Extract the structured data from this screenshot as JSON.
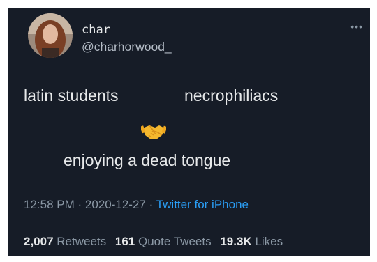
{
  "author": {
    "display_name": "char",
    "handle": "@charhorwood_"
  },
  "tweet": {
    "left_label": "latin students",
    "right_label": "necrophiliacs",
    "emoji_icon": "handshake-icon",
    "line2": "enjoying a dead tongue"
  },
  "meta": {
    "time": "12:58 PM",
    "sep1": "·",
    "date": "2020-12-27",
    "sep2": "·",
    "source": "Twitter for iPhone"
  },
  "stats": {
    "retweets_count": "2,007",
    "retweets_label": "Retweets",
    "quotes_count": "161",
    "quotes_label": "Quote Tweets",
    "likes_count": "19.3K",
    "likes_label": "Likes"
  },
  "colors": {
    "background": "#161c27",
    "text": "#e7e9ea",
    "muted": "#8b98a5",
    "link": "#2a9df4"
  }
}
